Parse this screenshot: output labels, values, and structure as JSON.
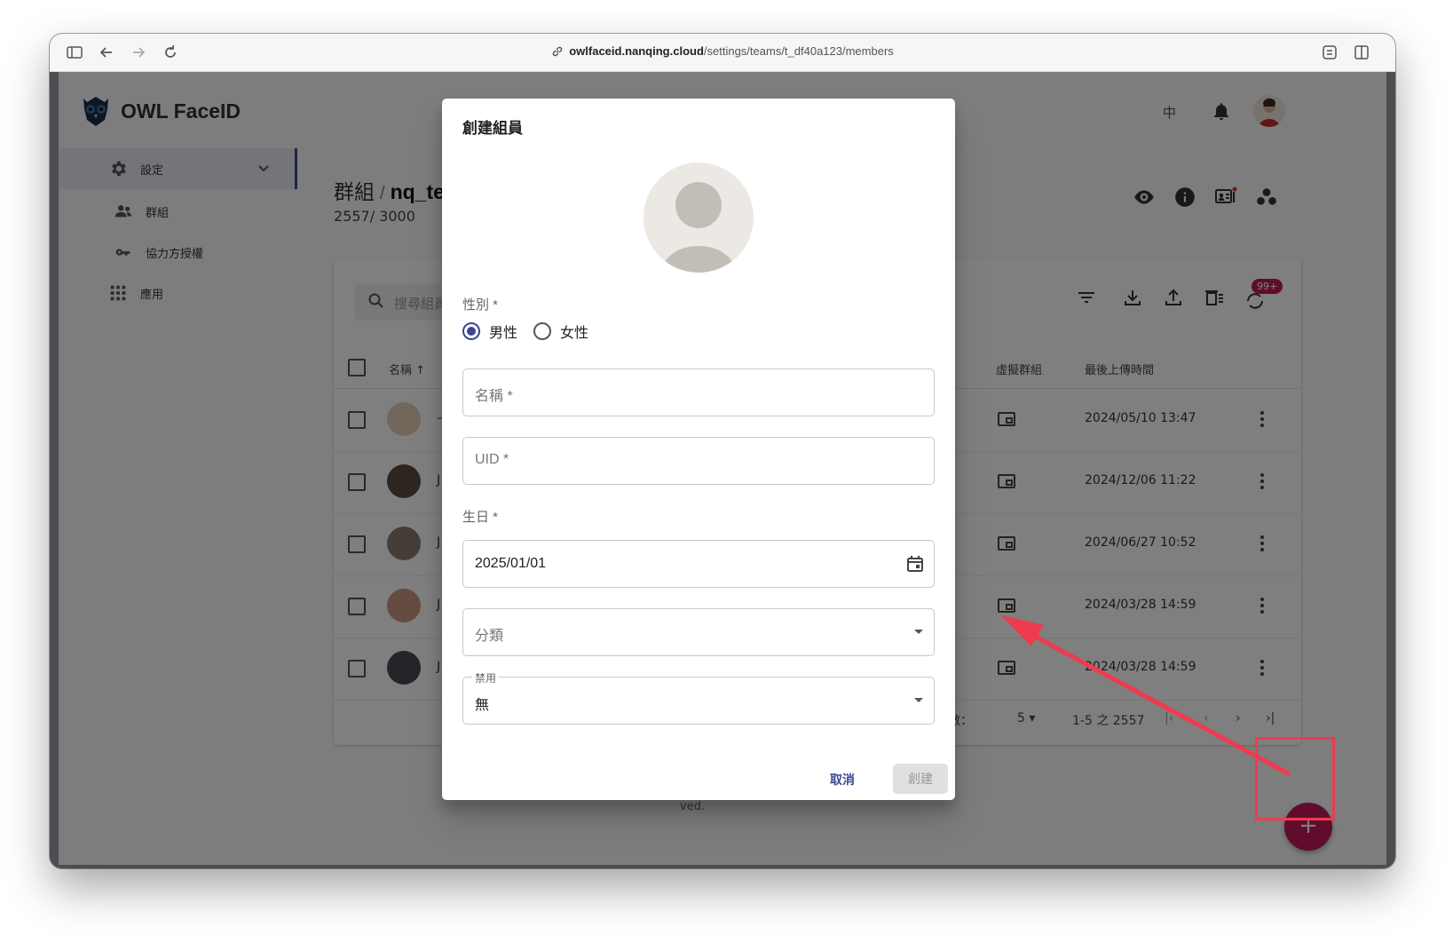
{
  "browser": {
    "url_host": "owlfaceid.nanqing.cloud",
    "url_path": "/settings/teams/t_df40a123/members"
  },
  "app": {
    "brand": "OWL FaceID",
    "lang_toggle": "中"
  },
  "sidebar": {
    "items": [
      {
        "label": "設定",
        "icon": "gear-icon"
      },
      {
        "label": "群組",
        "icon": "people-icon"
      },
      {
        "label": "協力方授權",
        "icon": "key-icon"
      },
      {
        "label": "應用",
        "icon": "apps-grid-icon"
      }
    ]
  },
  "page": {
    "breadcrumb_root": "群組",
    "breadcrumb_sep": "/",
    "breadcrumb_current": "nq_te",
    "count": "2557/ 3000"
  },
  "table": {
    "search_placeholder": "搜尋組員",
    "badge": "99+",
    "col_name": "名稱",
    "col_virtual_group": "虛擬群組",
    "col_last_upload": "最後上傳時間",
    "rows": [
      {
        "name": "—",
        "time": "2024/05/10 13:47"
      },
      {
        "name": "J",
        "time": "2024/12/06 11:22"
      },
      {
        "name": "J",
        "time": "2024/06/27 10:52"
      },
      {
        "name": "J",
        "time": "2024/03/28 14:59"
      },
      {
        "name": "J",
        "time": "2024/03/28 14:59"
      }
    ],
    "pager": {
      "rows_label": "每頁行數：",
      "rows_value": "5",
      "range": "1-5 之 2557"
    },
    "copyright_tail": "ved."
  },
  "dialog": {
    "title": "創建組員",
    "gender_label": "性別 *",
    "gender_male": "男性",
    "gender_female": "女性",
    "gender_selected": "男性",
    "name_label": "名稱 *",
    "uid_label": "UID *",
    "birthday_label": "生日 *",
    "birthday_value": "2025/01/01",
    "category_label": "分類",
    "disabled_label": "禁用",
    "disabled_value": "無",
    "cancel": "取消",
    "create": "創建"
  },
  "colors": {
    "primary": "#3a4790",
    "accent_fab": "#c2185b",
    "annotation": "#f03a4e"
  }
}
